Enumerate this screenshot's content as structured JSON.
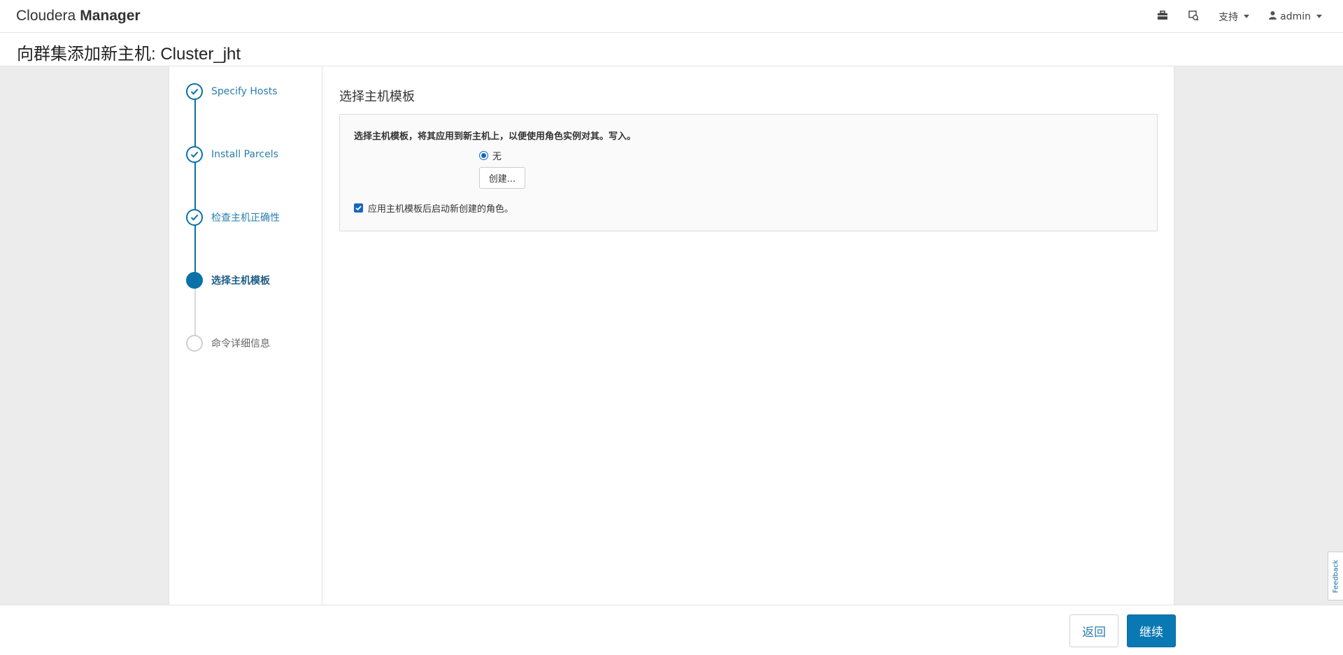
{
  "app": {
    "brand_light": "Cloudera",
    "brand_bold": "Manager"
  },
  "nav": {
    "support_label": "支持",
    "user_label": "admin",
    "icons": [
      "parcel-icon",
      "running-commands-icon",
      "user-icon"
    ]
  },
  "page": {
    "title": "向群集添加新主机: Cluster_jht"
  },
  "steps": [
    {
      "label": "Specify Hosts",
      "status": "done"
    },
    {
      "label": "Install Parcels",
      "status": "done"
    },
    {
      "label": "检查主机正确性",
      "status": "done"
    },
    {
      "label": "选择主机模板",
      "status": "active"
    },
    {
      "label": "命令详细信息",
      "status": "pending"
    }
  ],
  "content": {
    "section_title": "选择主机模板",
    "description": "选择主机模板，将其应用到新主机上，以便使用角色实例对其。写入。",
    "radio_option": "无",
    "create_button": "创建...",
    "checkbox_label": "应用主机模板后启动新创建的角色。"
  },
  "feedback": {
    "label": "Feedback"
  },
  "footer": {
    "back_label": "返回",
    "continue_label": "继续"
  },
  "colors": {
    "accent": "#0a78b3",
    "step_done": "#0a72a6",
    "step_pending": "#cfcfcf"
  }
}
